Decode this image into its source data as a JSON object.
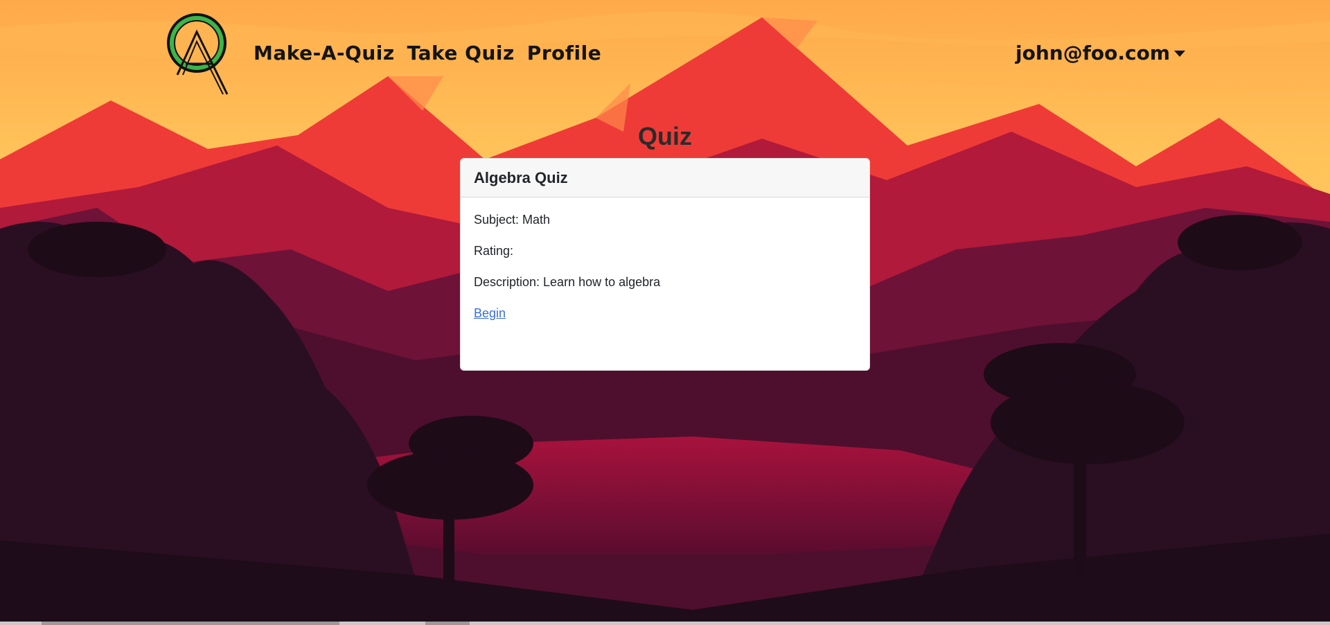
{
  "navbar": {
    "links": [
      "Make-A-Quiz",
      "Take Quiz",
      "Profile"
    ],
    "user_email": "john@foo.com",
    "logo_icon": "quiz-logo-icon"
  },
  "page": {
    "title": "Quiz"
  },
  "quiz_card": {
    "title": "Algebra Quiz",
    "subject": "Subject: Math",
    "rating": "Rating:",
    "description": "Description: Learn how to algebra",
    "begin_label": "Begin"
  },
  "colors": {
    "sky": "#ffc35a",
    "mountain_red": "#e8322f",
    "forest_dark": "#24101f",
    "link": "#3a6fd8",
    "logo_green": "#3cb54a"
  }
}
